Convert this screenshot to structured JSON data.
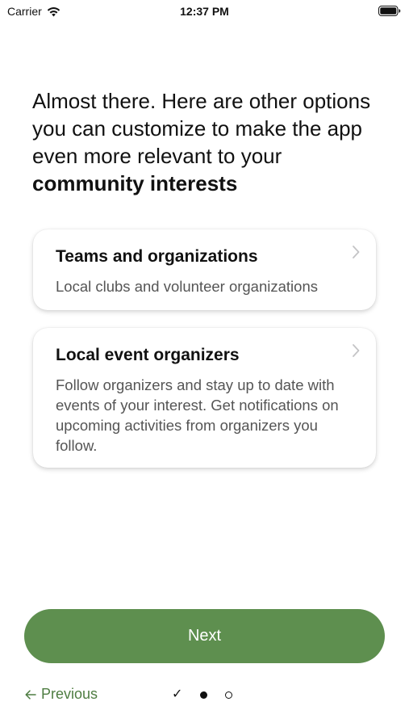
{
  "status_bar": {
    "carrier": "Carrier",
    "time": "12:37 PM"
  },
  "heading": {
    "text": "Almost there. Here are other options you can customize to make the app even more relevant to your ",
    "emphasis": "community interests"
  },
  "cards": [
    {
      "title": "Teams and organizations",
      "description": "Local clubs and volunteer organizations",
      "icon": "chevron-right-icon"
    },
    {
      "title": "Local event organizers",
      "description": "Follow organizers and stay up to date with events of your interest. Get notifications on upcoming activities from organizers you follow.",
      "icon": "chevron-right-icon"
    }
  ],
  "next_button": {
    "label": "Next"
  },
  "footer": {
    "previous_label": "Previous",
    "previous_icon": "arrow-left-icon",
    "page_indicator": {
      "completed_glyph": "✓",
      "current_step": 2,
      "total_steps": 3
    }
  },
  "colors": {
    "accent": "#5e8f4f",
    "link": "#4e7d42",
    "secondary_text": "#555555"
  }
}
